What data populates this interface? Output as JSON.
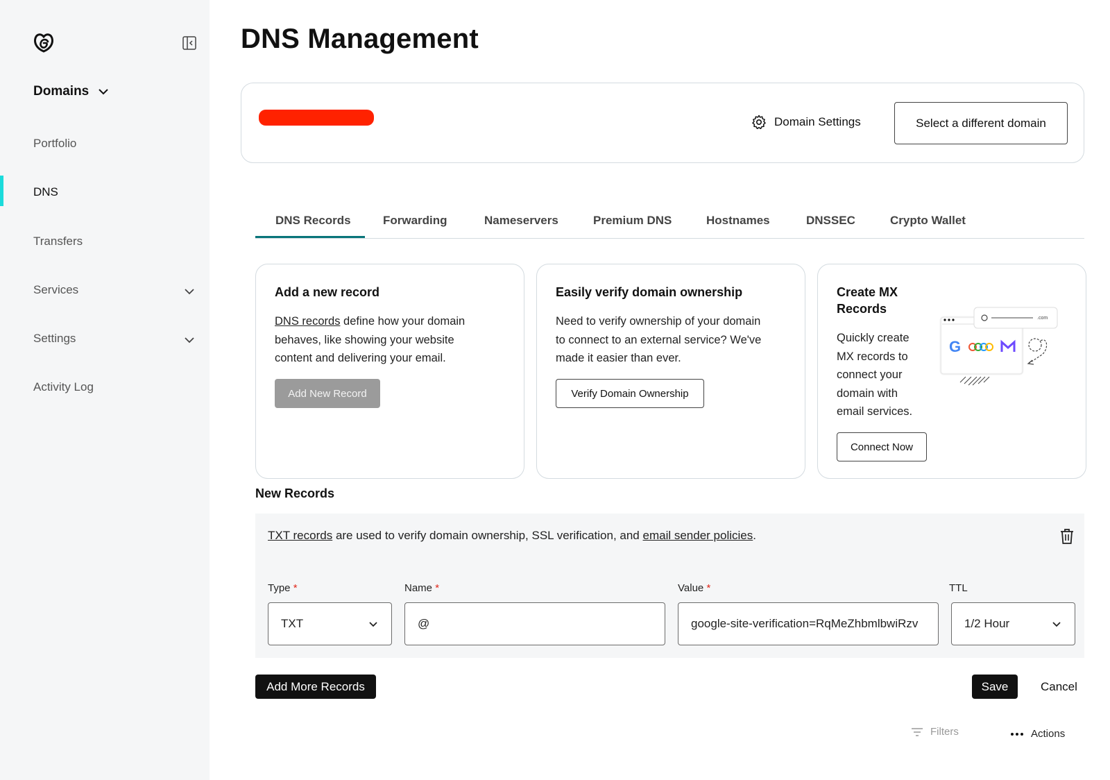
{
  "page_title": "DNS Management",
  "sidebar": {
    "section": "Domains",
    "items": [
      {
        "label": "Portfolio"
      },
      {
        "label": "DNS"
      },
      {
        "label": "Transfers"
      },
      {
        "label": "Services"
      },
      {
        "label": "Settings"
      },
      {
        "label": "Activity Log"
      }
    ]
  },
  "domain_card": {
    "settings_label": "Domain Settings",
    "select_button": "Select a different domain"
  },
  "tabs": [
    {
      "label": "DNS Records"
    },
    {
      "label": "Forwarding"
    },
    {
      "label": "Nameservers"
    },
    {
      "label": "Premium DNS"
    },
    {
      "label": "Hostnames"
    },
    {
      "label": "DNSSEC"
    },
    {
      "label": "Crypto Wallet"
    }
  ],
  "cards": {
    "add": {
      "title": "Add a new record",
      "link": "DNS records",
      "text": " define how your domain behaves, like showing your website content and delivering your email.",
      "button": "Add New Record"
    },
    "verify": {
      "title": "Easily verify domain ownership",
      "text": "Need to verify ownership of your domain to connect to an external service? We've made it easier than ever.",
      "button": "Verify Domain Ownership"
    },
    "mx": {
      "title": "Create MX Records",
      "text": "Quickly create MX records to connect your domain with email services.",
      "button": "Connect Now",
      "illustration_text": ".com"
    }
  },
  "new_records": {
    "title": "New Records",
    "desc_link1": "TXT records",
    "desc_mid": " are used to verify domain ownership, SSL verification, and ",
    "desc_link2": "email sender policies",
    "desc_end": ".",
    "fields": {
      "type": {
        "label": "Type",
        "value": "TXT"
      },
      "name": {
        "label": "Name",
        "value": "@"
      },
      "value": {
        "label": "Value",
        "value": "google-site-verification=RqMeZhbmlbwiRzv"
      },
      "ttl": {
        "label": "TTL",
        "value": "1/2 Hour"
      }
    },
    "required_mark": "*"
  },
  "buttons": {
    "add_more": "Add More Records",
    "save": "Save",
    "cancel": "Cancel"
  },
  "toolbar": {
    "filters": "Filters",
    "actions": "Actions"
  },
  "colors": {
    "accent_teal": "#09757a",
    "active_nav": "#1bdbdb",
    "redaction": "#ff2200",
    "required": "#e0271b"
  }
}
